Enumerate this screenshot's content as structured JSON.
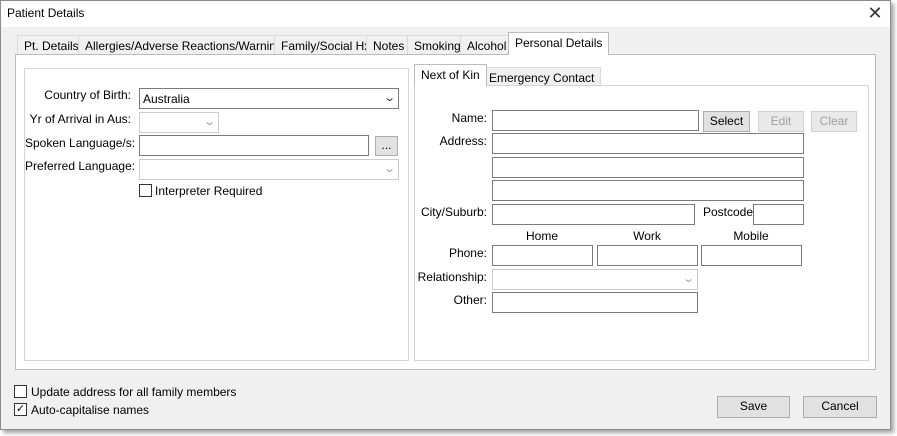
{
  "window": {
    "title": "Patient Details"
  },
  "tabs": [
    {
      "label": "Pt. Details"
    },
    {
      "label": "Allergies/Adverse Reactions/Warnings"
    },
    {
      "label": "Family/Social Hx"
    },
    {
      "label": "Notes"
    },
    {
      "label": "Smoking"
    },
    {
      "label": "Alcohol"
    },
    {
      "label": "Personal Details"
    }
  ],
  "personal": {
    "country_label": "Country of Birth:",
    "country_value": "Australia",
    "arrival_label": "Yr of Arrival in Aus:",
    "arrival_value": "",
    "spoken_label": "Spoken Language/s:",
    "spoken_value": "",
    "spoken_button": "...",
    "preferred_label": "Preferred Language:",
    "preferred_value": "",
    "interpreter_label": "Interpreter Required",
    "interpreter_checked": false
  },
  "subtabs": [
    {
      "label": "Next of Kin"
    },
    {
      "label": "Emergency Contact"
    }
  ],
  "kin": {
    "name_label": "Name:",
    "name_value": "",
    "select_button": "Select",
    "edit_button": "Edit",
    "clear_button": "Clear",
    "address_label": "Address:",
    "address_lines": [
      "",
      "",
      ""
    ],
    "city_label": "City/Suburb:",
    "city_value": "",
    "postcode_label": "Postcode:",
    "postcode_value": "",
    "phone_label": "Phone:",
    "phone_home_header": "Home",
    "phone_work_header": "Work",
    "phone_mobile_header": "Mobile",
    "phone_home": "",
    "phone_work": "",
    "phone_mobile": "",
    "relationship_label": "Relationship:",
    "relationship_value": "",
    "other_label": "Other:",
    "other_value": ""
  },
  "footer": {
    "update_address_label": "Update address for all family members",
    "update_address_checked": false,
    "autocap_label": "Auto-capitalise names",
    "autocap_checked": true,
    "save_button": "Save",
    "cancel_button": "Cancel"
  }
}
